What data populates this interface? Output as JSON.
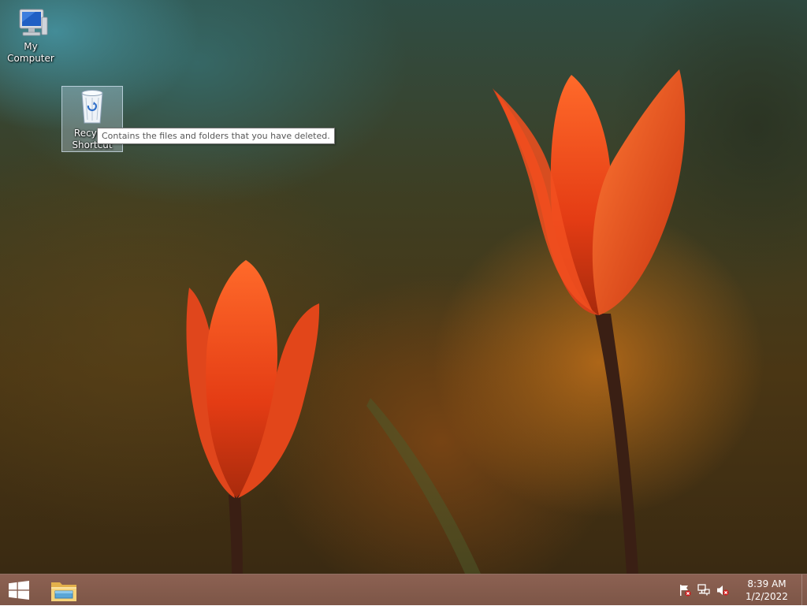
{
  "desktop": {
    "icons": [
      {
        "label": "My Computer",
        "icon": "computer-icon"
      },
      {
        "label": "Recycle Bin - Shortcut",
        "label_lines": [
          "Recycle",
          "Shortcut"
        ],
        "icon": "recycle-bin-icon",
        "selected": true
      }
    ],
    "tooltip": "Contains the files and folders that you have deleted."
  },
  "taskbar": {
    "start_icon": "windows-logo-icon",
    "pinned": [
      {
        "icon": "file-explorer-icon"
      }
    ],
    "tray_icons": [
      "action-center-flag-icon",
      "network-icon",
      "volume-muted-icon"
    ],
    "time": "8:39 AM",
    "date": "1/2/2022"
  },
  "colors": {
    "taskbar": "#8c6152",
    "tooltip_bg": "#ffffff",
    "tooltip_border": "#767676",
    "tulip": "#e8431c"
  }
}
